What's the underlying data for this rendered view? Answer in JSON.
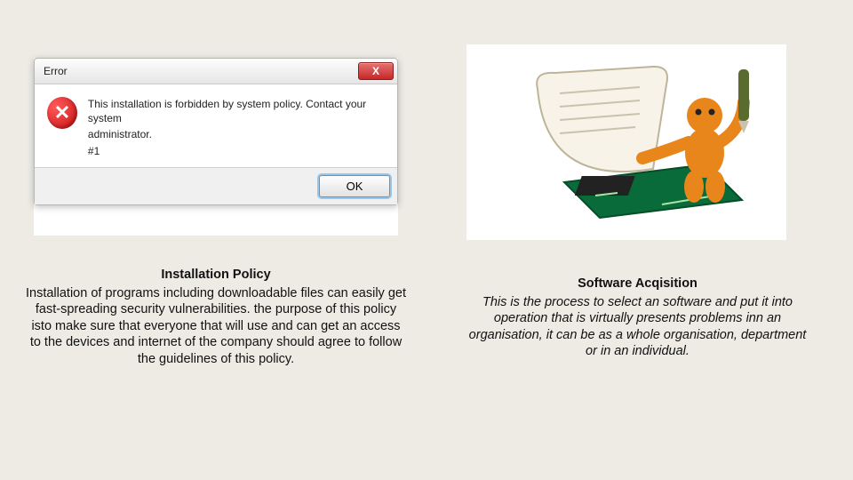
{
  "dialog": {
    "title": "Error",
    "close_glyph": "X",
    "icon_glyph": "✕",
    "message_line1": "This installation is forbidden by system policy. Contact your system",
    "message_line2": "administrator.",
    "message_line3": "#1",
    "ok_label": "OK"
  },
  "left": {
    "heading": "Installation Policy",
    "body": "Installation of programs including downloadable files can easily get fast-spreading security vulnerabilities. the purpose of this policy isto make sure that everyone that will use and can get an access to the devices and internet of the company should agree to follow the guidelines of this policy."
  },
  "right": {
    "heading": "Software Acqisition",
    "body": "This is the process to select an software and put it into operation that is virtually presents problems inn an organisation, it can be as a whole organisation, department or in an individual."
  }
}
